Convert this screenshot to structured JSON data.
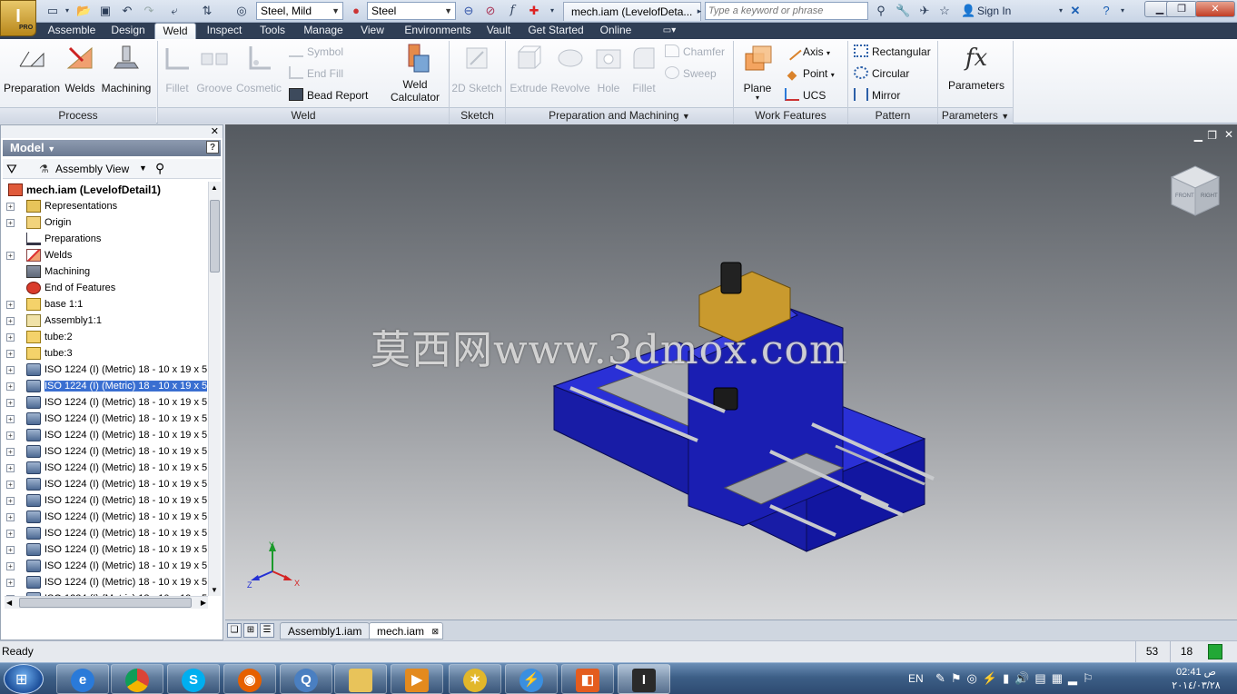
{
  "titlebar": {
    "material": "Steel, Mild",
    "appearance": "Steel",
    "document_title": "mech.iam (LevelofDeta...",
    "search_placeholder": "Type a keyword or phrase",
    "sign_in": "Sign In"
  },
  "app_button": {
    "pro_label": "PRO"
  },
  "tabs": [
    "Assemble",
    "Design",
    "Weld",
    "Inspect",
    "Tools",
    "Manage",
    "View",
    "Environments",
    "Vault",
    "Get Started",
    "Online"
  ],
  "active_tab": "Weld",
  "ribbon": {
    "process": {
      "label": "Process",
      "preparation": "Preparation",
      "welds": "Welds",
      "machining": "Machining"
    },
    "weld": {
      "label": "Weld",
      "fillet": "Fillet",
      "groove": "Groove",
      "cosmetic": "Cosmetic",
      "symbol": "Symbol",
      "end_fill": "End Fill",
      "bead_report": "Bead Report",
      "weld_calculator_line1": "Weld",
      "weld_calculator_line2": "Calculator"
    },
    "sketch": {
      "label": "Sketch",
      "sketch_2d": "2D Sketch"
    },
    "prep_machining": {
      "label": "Preparation and Machining",
      "extrude": "Extrude",
      "revolve": "Revolve",
      "hole": "Hole",
      "fillet": "Fillet",
      "chamfer": "Chamfer",
      "sweep": "Sweep"
    },
    "work_features": {
      "label": "Work Features",
      "plane": "Plane",
      "axis": "Axis",
      "point": "Point",
      "ucs": "UCS"
    },
    "pattern": {
      "label": "Pattern",
      "rectangular": "Rectangular",
      "circular": "Circular",
      "mirror": "Mirror"
    },
    "parameters": {
      "label": "Parameters",
      "parameters_btn": "Parameters"
    }
  },
  "browser": {
    "header": "Model",
    "view_mode": "Assembly View",
    "root": "mech.iam (LevelofDetail1)",
    "items": [
      {
        "label": "Representations",
        "expander": "+",
        "icon": "representations"
      },
      {
        "label": "Origin",
        "expander": "+",
        "icon": "folder"
      },
      {
        "label": "Preparations",
        "expander": "",
        "icon": "preparation"
      },
      {
        "label": "Welds",
        "expander": "+",
        "icon": "weld"
      },
      {
        "label": "Machining",
        "expander": "",
        "icon": "machining"
      },
      {
        "label": "End of Features",
        "expander": "",
        "icon": "end"
      },
      {
        "label": "base 1:1",
        "expander": "+",
        "icon": "part"
      },
      {
        "label": "Assembly1:1",
        "expander": "+",
        "icon": "assembly"
      },
      {
        "label": "tube:2",
        "expander": "+",
        "icon": "part"
      },
      {
        "label": "tube:3",
        "expander": "+",
        "icon": "part"
      },
      {
        "label": "ISO 1224 (I) (Metric) 18 - 10 x 19 x 5",
        "expander": "+",
        "icon": "bearing"
      },
      {
        "label": "ISO 1224 (I) (Metric) 18 - 10 x 19 x 5",
        "expander": "+",
        "icon": "bearing",
        "selected": true
      },
      {
        "label": "ISO 1224 (I) (Metric) 18 - 10 x 19 x 5",
        "expander": "+",
        "icon": "bearing"
      },
      {
        "label": "ISO 1224 (I) (Metric) 18 - 10 x 19 x 5",
        "expander": "+",
        "icon": "bearing"
      },
      {
        "label": "ISO 1224 (I) (Metric) 18 - 10 x 19 x 5",
        "expander": "+",
        "icon": "bearing"
      },
      {
        "label": "ISO 1224 (I) (Metric) 18 - 10 x 19 x 5",
        "expander": "+",
        "icon": "bearing"
      },
      {
        "label": "ISO 1224 (I) (Metric) 18 - 10 x 19 x 5",
        "expander": "+",
        "icon": "bearing"
      },
      {
        "label": "ISO 1224 (I) (Metric) 18 - 10 x 19 x 5",
        "expander": "+",
        "icon": "bearing"
      },
      {
        "label": "ISO 1224 (I) (Metric) 18 - 10 x 19 x 5",
        "expander": "+",
        "icon": "bearing"
      },
      {
        "label": "ISO 1224 (I) (Metric) 18 - 10 x 19 x 5",
        "expander": "+",
        "icon": "bearing"
      },
      {
        "label": "ISO 1224 (I) (Metric) 18 - 10 x 19 x 5",
        "expander": "+",
        "icon": "bearing"
      },
      {
        "label": "ISO 1224 (I) (Metric) 18 - 10 x 19 x 5",
        "expander": "+",
        "icon": "bearing"
      },
      {
        "label": "ISO 1224 (I) (Metric) 18 - 10 x 19 x 5",
        "expander": "+",
        "icon": "bearing"
      },
      {
        "label": "ISO 1224 (I) (Metric) 18 - 10 x 19 x 5",
        "expander": "+",
        "icon": "bearing"
      },
      {
        "label": "ISO 1224 (I) (Metric) 18 - 10 x 19 x 5",
        "expander": "+",
        "icon": "bearing"
      }
    ]
  },
  "viewport": {
    "watermark": "莫西网www.3dmox.com",
    "viewcube_faces": [
      "FRONT",
      "RIGHT"
    ],
    "axes": {
      "x": "X",
      "y": "Y",
      "z": "Z"
    }
  },
  "doc_tabs": [
    "Assembly1.iam",
    "mech.iam"
  ],
  "status": {
    "text": "Ready",
    "count1": "53",
    "count2": "18"
  },
  "taskbar": {
    "lang": "EN",
    "time": "02:41 ص",
    "date": "٢٠١٤/٠٣/٢٨"
  },
  "colors": {
    "accent": "#3a6fd1",
    "model_blue": "#1a1fb0",
    "tab_bar": "#2f3e55"
  }
}
